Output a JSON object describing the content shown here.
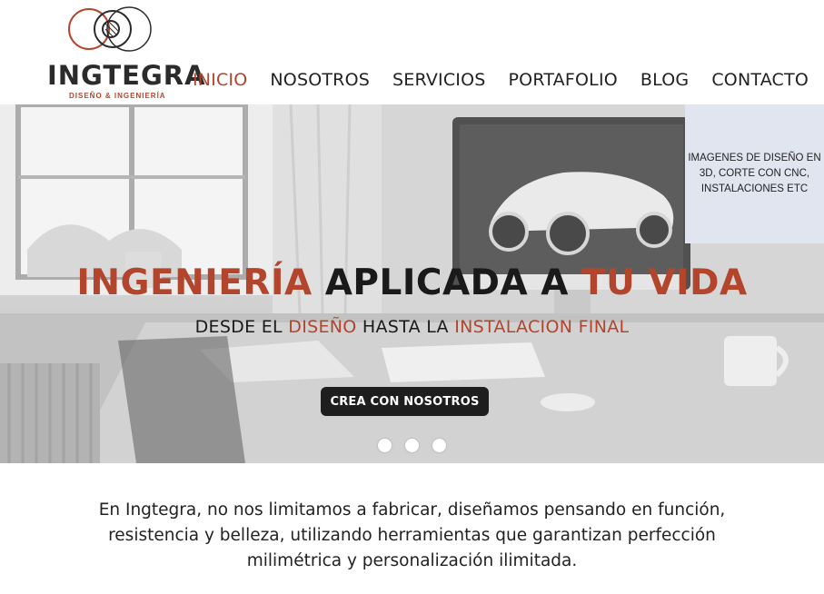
{
  "brand": {
    "name": "INGTEGRA",
    "tagline": "DISEÑO & INGENIERÍA",
    "accent_color": "#b3452c"
  },
  "nav": {
    "items": [
      {
        "label": "INICIO",
        "active": true
      },
      {
        "label": "NOSOTROS",
        "active": false
      },
      {
        "label": "SERVICIOS",
        "active": false
      },
      {
        "label": "PORTAFOLIO",
        "active": false
      },
      {
        "label": "BLOG",
        "active": false
      },
      {
        "label": "CONTACTO",
        "active": false
      }
    ]
  },
  "hero": {
    "title_part1": "INGENIERÍA",
    "title_part2": "APLICADA A",
    "title_part3": "TU VIDA",
    "sub_part1": "DESDE EL",
    "sub_part2": "DISEÑO",
    "sub_part3": "HASTA LA",
    "sub_part4": "INSTALACION FINAL",
    "cta_label": "CREA CON NOSOTROS",
    "slide_count": 3,
    "info_box_text": "IMAGENES DE DISEÑO EN 3D, CORTE CON CNC, INSTALACIONES ETC"
  },
  "intro": {
    "text": "En Ingtegra, no nos limitamos a fabricar, diseñamos pensando en función, resistencia y belleza, utilizando herramientas que garantizan perfección milimétrica y personalización ilimitada."
  }
}
